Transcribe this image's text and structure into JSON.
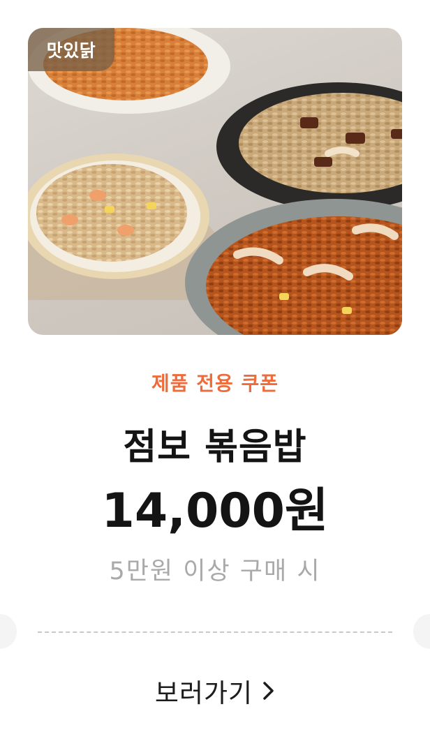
{
  "brand": {
    "badge": "맛있닭"
  },
  "coupon": {
    "label": "제품 전용 쿠폰",
    "product_name": "점보 볶음밥",
    "price": "14,000원",
    "condition": "5만원 이상 구매 시"
  },
  "cta": {
    "label": "보러가기",
    "icon": "chevron-right-icon"
  },
  "colors": {
    "accent": "#ee6b3b",
    "text": "#141414",
    "muted": "#a9a9a9",
    "badge_bg": "#786048"
  }
}
